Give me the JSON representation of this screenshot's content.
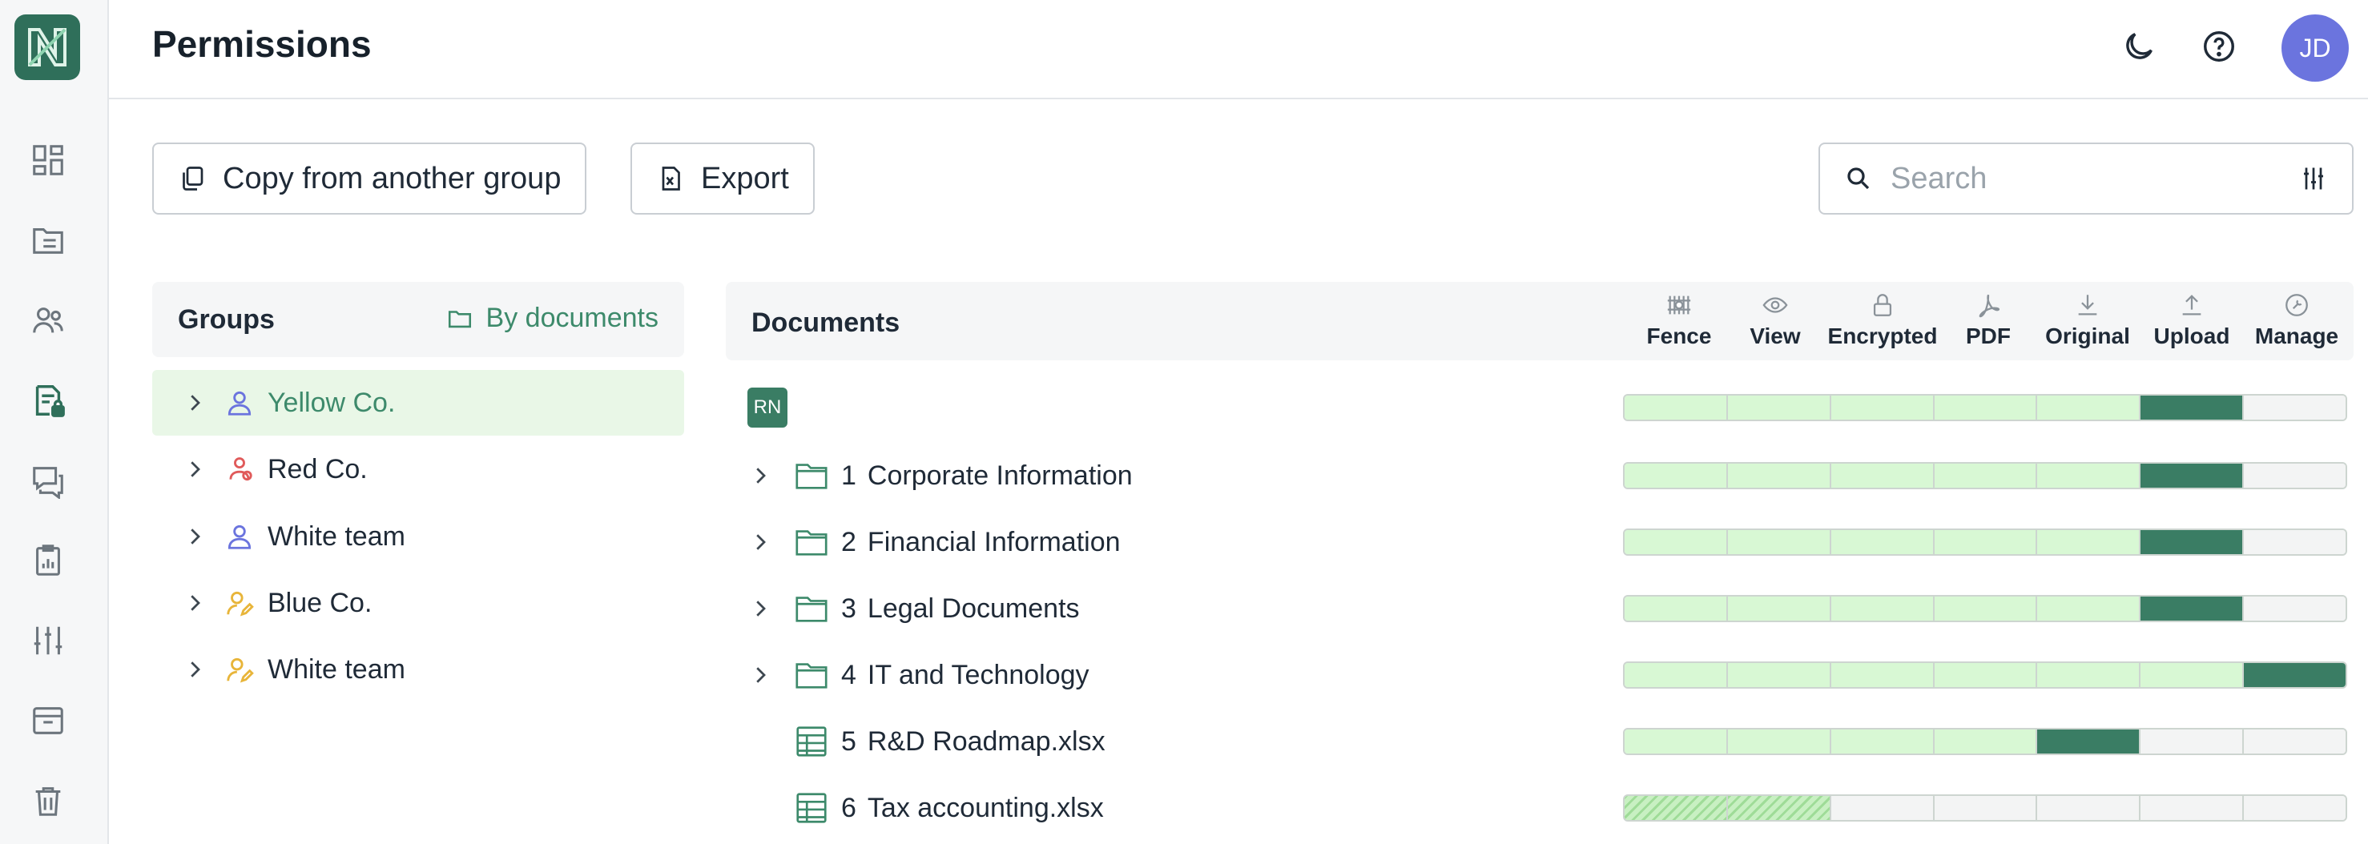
{
  "header": {
    "title": "Permissions",
    "avatar_initials": "JD"
  },
  "toolbar": {
    "copy_label": "Copy from another group",
    "export_label": "Export",
    "search_placeholder": "Search"
  },
  "groups": {
    "title": "Groups",
    "by_documents_label": "By documents",
    "items": [
      {
        "name": "Yellow Co.",
        "icon": "user-icon",
        "icon_color": "#6b74de",
        "selected": true
      },
      {
        "name": "Red Co.",
        "icon": "user-group-icon",
        "icon_color": "#e05a5a",
        "selected": false
      },
      {
        "name": "White team",
        "icon": "user-icon",
        "icon_color": "#6b74de",
        "selected": false
      },
      {
        "name": "Blue Co.",
        "icon": "user-edit-icon",
        "icon_color": "#e8b53a",
        "selected": false
      },
      {
        "name": "White team",
        "icon": "user-edit-icon",
        "icon_color": "#e8b53a",
        "selected": false
      }
    ]
  },
  "documents": {
    "title": "Documents",
    "columns": [
      "Fence",
      "View",
      "Encrypted",
      "PDF",
      "Original",
      "Upload",
      "Manage"
    ],
    "root_badge": "RN",
    "rows": [
      {
        "num": "1",
        "name": "Corporate Information",
        "type": "folder"
      },
      {
        "num": "2",
        "name": "Financial Information",
        "type": "folder"
      },
      {
        "num": "3",
        "name": "Legal Documents",
        "type": "folder"
      },
      {
        "num": "4",
        "name": "IT and Technology",
        "type": "folder"
      },
      {
        "num": "5",
        "name": "R&D Roadmap.xlsx",
        "type": "spreadsheet"
      },
      {
        "num": "6",
        "name": "Tax accounting.xlsx",
        "type": "spreadsheet"
      }
    ],
    "permission_levels": {
      "root": "Upload",
      "1": "Upload",
      "2": "Upload",
      "3": "Upload",
      "4": "Manage",
      "5": "Original",
      "6": "View (partial)"
    }
  },
  "colors": {
    "brand": "#2f6f5a",
    "accent_green": "#3d8a6b",
    "granted_fill": "#d8f8d4",
    "level_fill": "#3a7d64",
    "selected_row_bg": "#e9f7e7",
    "avatar_bg": "#6b74de"
  }
}
